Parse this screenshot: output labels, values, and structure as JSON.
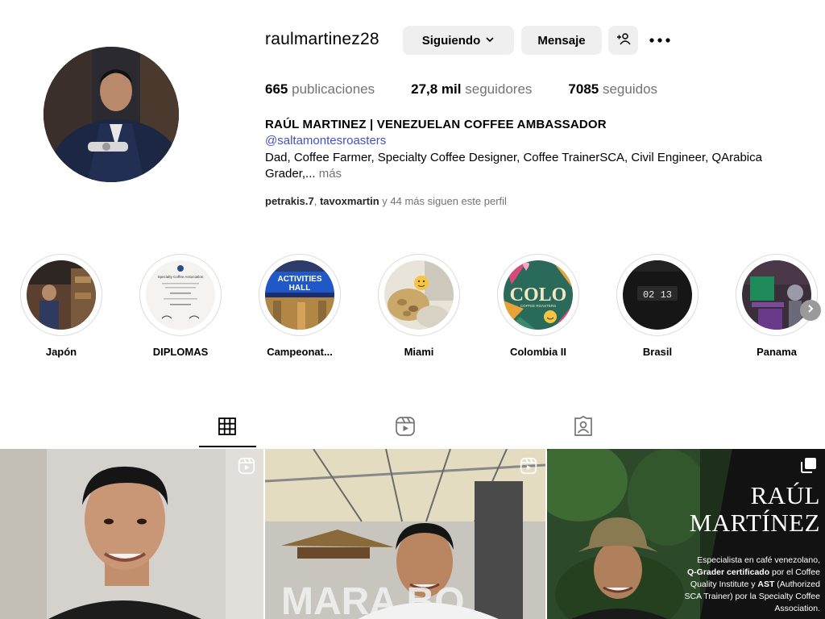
{
  "profile": {
    "username": "raulmartinez28",
    "follow_label": "Siguiendo",
    "message_label": "Mensaje",
    "stats": {
      "posts_value": "665",
      "posts_label": "publicaciones",
      "followers_value": "27,8 mil",
      "followers_label": "seguidores",
      "following_value": "7085",
      "following_label": "seguidos"
    },
    "full_name": "RAÚL MARTINEZ | VENEZUELAN COFFEE AMBASSADOR",
    "link": "@saltamontesroasters",
    "bio": "Dad, Coffee Farmer, Specialty Coffee Designer, Coffee TrainerSCA, Civil Engineer, QArabica Grader,...",
    "bio_more": "más",
    "followed_by": {
      "user1": "petrakis.7",
      "separator": ",",
      "user2": "tavoxmartin",
      "rest": "y 44 más siguen este perfil"
    }
  },
  "highlights": [
    {
      "label": "Japón"
    },
    {
      "label": "DIPLOMAS"
    },
    {
      "label": "Campeonat..."
    },
    {
      "label": "Miami"
    },
    {
      "label": "Colombia II"
    },
    {
      "label": "Brasil"
    },
    {
      "label": "Panama"
    }
  ],
  "highlight_texts": {
    "diploma_title": "Specialty Coffee Association",
    "activities": "ACTIVITIES",
    "hall": "HALL",
    "colo": "COLO",
    "coffee_roasters": "COFFEE ROASTERS",
    "timer": "02 13"
  },
  "tabs": [
    {
      "name": "posts",
      "icon": "grid-icon",
      "active": true
    },
    {
      "name": "reels",
      "icon": "reels-icon",
      "active": false
    },
    {
      "name": "tagged",
      "icon": "tagged-icon",
      "active": false
    }
  ],
  "posts": [
    {
      "type": "reel",
      "icon": "reel-badge-icon"
    },
    {
      "type": "reel",
      "icon": "reel-badge-icon",
      "sign_text": "MARA BO"
    },
    {
      "type": "carousel",
      "icon": "carousel-badge-icon",
      "title_line1": "RAÚL",
      "title_line2": "MARTÍNEZ",
      "desc_1": "Especialista en café venezolano,",
      "desc_2_bold": "Q-Grader certificado",
      "desc_2_rest": " por el Coffee",
      "desc_3": "Quality Institute y ",
      "desc_3_bold": "AST",
      "desc_3_rest": " (Authorized",
      "desc_4": "SCA Trainer) por la Specialty Coffee",
      "desc_5": "Association."
    }
  ],
  "colors": {
    "link": "#4150c9",
    "secondary_text": "#737373",
    "button_bg": "#efefef"
  }
}
